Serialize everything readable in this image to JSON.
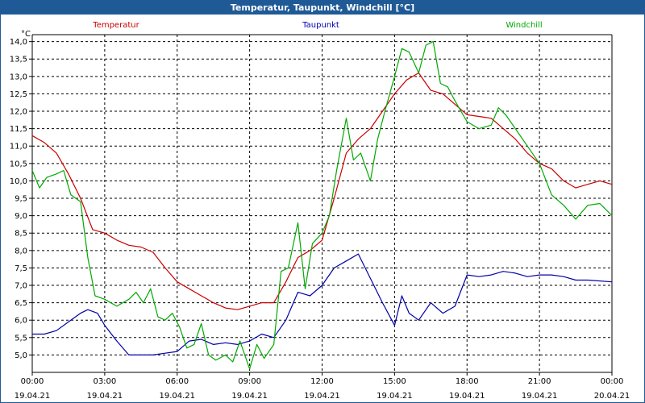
{
  "window_title": "Temperatur, Taupunkt, Windchill [°C]",
  "colors": {
    "titlebar": "#1f5a96",
    "temperatur": "#cc0000",
    "taupunkt": "#0000aa",
    "windchill": "#00aa00",
    "grid": "#000000"
  },
  "chart_data": {
    "type": "line",
    "title": "Temperatur, Taupunkt, Windchill [°C]",
    "ylabel": "°C",
    "ylim": [
      4.5,
      14.2
    ],
    "xlim": [
      0,
      24
    ],
    "grid": true,
    "yticks": [
      "5,0",
      "5,5",
      "6,0",
      "6,5",
      "7,0",
      "7,5",
      "8,0",
      "8,5",
      "9,0",
      "9,5",
      "10,0",
      "10,5",
      "11,0",
      "11,5",
      "12,0",
      "12,5",
      "13,0",
      "13,5",
      "14,0"
    ],
    "xticks": [
      {
        "time": "00:00",
        "date": "19.04.21"
      },
      {
        "time": "03:00",
        "date": "19.04.21"
      },
      {
        "time": "06:00",
        "date": "19.04.21"
      },
      {
        "time": "09:00",
        "date": "19.04.21"
      },
      {
        "time": "12:00",
        "date": "19.04.21"
      },
      {
        "time": "15:00",
        "date": "19.04.21"
      },
      {
        "time": "18:00",
        "date": "19.04.21"
      },
      {
        "time": "21:00",
        "date": "19.04.21"
      },
      {
        "time": "00:00",
        "date": "20.04.21"
      }
    ],
    "series": [
      {
        "name": "Temperatur",
        "color": "#cc0000",
        "points": [
          [
            0,
            11.3
          ],
          [
            0.5,
            11.1
          ],
          [
            1,
            10.8
          ],
          [
            1.5,
            10.2
          ],
          [
            2,
            9.5
          ],
          [
            2.5,
            8.6
          ],
          [
            3,
            8.5
          ],
          [
            3.5,
            8.3
          ],
          [
            4,
            8.15
          ],
          [
            4.5,
            8.1
          ],
          [
            5,
            7.95
          ],
          [
            5.5,
            7.5
          ],
          [
            6,
            7.1
          ],
          [
            6.5,
            6.9
          ],
          [
            7,
            6.7
          ],
          [
            7.5,
            6.5
          ],
          [
            8,
            6.35
          ],
          [
            8.5,
            6.3
          ],
          [
            9,
            6.4
          ],
          [
            9.5,
            6.5
          ],
          [
            10,
            6.5
          ],
          [
            10.5,
            7.1
          ],
          [
            11,
            7.8
          ],
          [
            11.5,
            8.0
          ],
          [
            12,
            8.3
          ],
          [
            12.5,
            9.5
          ],
          [
            13,
            10.8
          ],
          [
            13.5,
            11.2
          ],
          [
            14,
            11.5
          ],
          [
            14.5,
            12.0
          ],
          [
            15,
            12.5
          ],
          [
            15.5,
            12.9
          ],
          [
            16,
            13.1
          ],
          [
            16.5,
            12.6
          ],
          [
            17,
            12.5
          ],
          [
            17.5,
            12.2
          ],
          [
            18,
            11.9
          ],
          [
            18.5,
            11.85
          ],
          [
            19,
            11.8
          ],
          [
            19.5,
            11.5
          ],
          [
            20,
            11.2
          ],
          [
            20.5,
            10.8
          ],
          [
            21,
            10.5
          ],
          [
            21.5,
            10.35
          ],
          [
            22,
            10.0
          ],
          [
            22.5,
            9.8
          ],
          [
            23,
            9.9
          ],
          [
            23.5,
            10.0
          ],
          [
            24,
            9.9
          ]
        ]
      },
      {
        "name": "Taupunkt",
        "color": "#0000aa",
        "points": [
          [
            0,
            5.6
          ],
          [
            0.5,
            5.6
          ],
          [
            1,
            5.7
          ],
          [
            1.5,
            5.95
          ],
          [
            2,
            6.2
          ],
          [
            2.3,
            6.3
          ],
          [
            2.7,
            6.2
          ],
          [
            3,
            5.85
          ],
          [
            3.5,
            5.4
          ],
          [
            4,
            5.0
          ],
          [
            4.5,
            5.0
          ],
          [
            5,
            5.0
          ],
          [
            5.5,
            5.05
          ],
          [
            6,
            5.1
          ],
          [
            6.5,
            5.4
          ],
          [
            7,
            5.45
          ],
          [
            7.5,
            5.3
          ],
          [
            8,
            5.35
          ],
          [
            8.5,
            5.3
          ],
          [
            9,
            5.4
          ],
          [
            9.5,
            5.6
          ],
          [
            10,
            5.5
          ],
          [
            10.5,
            6.0
          ],
          [
            11,
            6.8
          ],
          [
            11.5,
            6.7
          ],
          [
            12,
            7.0
          ],
          [
            12.5,
            7.5
          ],
          [
            13,
            7.7
          ],
          [
            13.5,
            7.9
          ],
          [
            14,
            7.2
          ],
          [
            14.5,
            6.5
          ],
          [
            15,
            5.85
          ],
          [
            15.3,
            6.7
          ],
          [
            15.6,
            6.2
          ],
          [
            16,
            6.0
          ],
          [
            16.5,
            6.5
          ],
          [
            17,
            6.2
          ],
          [
            17.5,
            6.4
          ],
          [
            18,
            7.3
          ],
          [
            18.5,
            7.25
          ],
          [
            19,
            7.3
          ],
          [
            19.5,
            7.4
          ],
          [
            20,
            7.35
          ],
          [
            20.5,
            7.25
          ],
          [
            21,
            7.3
          ],
          [
            21.5,
            7.3
          ],
          [
            22,
            7.25
          ],
          [
            22.5,
            7.15
          ],
          [
            23,
            7.15
          ],
          [
            24,
            7.1
          ]
        ]
      },
      {
        "name": "Windchill",
        "color": "#00aa00",
        "points": [
          [
            0,
            10.3
          ],
          [
            0.3,
            9.8
          ],
          [
            0.6,
            10.1
          ],
          [
            1,
            10.2
          ],
          [
            1.3,
            10.3
          ],
          [
            1.6,
            9.6
          ],
          [
            2,
            9.4
          ],
          [
            2.3,
            7.8
          ],
          [
            2.6,
            6.7
          ],
          [
            3,
            6.6
          ],
          [
            3.5,
            6.4
          ],
          [
            4,
            6.6
          ],
          [
            4.3,
            6.8
          ],
          [
            4.6,
            6.5
          ],
          [
            4.9,
            6.9
          ],
          [
            5.2,
            6.1
          ],
          [
            5.5,
            6.0
          ],
          [
            5.8,
            6.2
          ],
          [
            6.1,
            5.8
          ],
          [
            6.4,
            5.2
          ],
          [
            6.7,
            5.3
          ],
          [
            7,
            5.9
          ],
          [
            7.3,
            5.0
          ],
          [
            7.6,
            4.85
          ],
          [
            8,
            5.0
          ],
          [
            8.3,
            4.8
          ],
          [
            8.6,
            5.4
          ],
          [
            9,
            4.6
          ],
          [
            9.3,
            5.3
          ],
          [
            9.6,
            4.9
          ],
          [
            10,
            5.3
          ],
          [
            10.3,
            7.4
          ],
          [
            10.6,
            7.5
          ],
          [
            11,
            8.8
          ],
          [
            11.3,
            6.9
          ],
          [
            11.6,
            8.2
          ],
          [
            12,
            8.5
          ],
          [
            12.3,
            9.0
          ],
          [
            12.6,
            10.3
          ],
          [
            13,
            11.8
          ],
          [
            13.3,
            10.6
          ],
          [
            13.6,
            10.8
          ],
          [
            14,
            10.0
          ],
          [
            14.3,
            11.2
          ],
          [
            14.6,
            12.0
          ],
          [
            15,
            13.0
          ],
          [
            15.3,
            13.8
          ],
          [
            15.6,
            13.7
          ],
          [
            16,
            13.1
          ],
          [
            16.3,
            13.9
          ],
          [
            16.6,
            14.0
          ],
          [
            16.9,
            12.8
          ],
          [
            17.2,
            12.7
          ],
          [
            17.5,
            12.3
          ],
          [
            18,
            11.7
          ],
          [
            18.5,
            11.5
          ],
          [
            19,
            11.6
          ],
          [
            19.3,
            12.1
          ],
          [
            19.6,
            11.9
          ],
          [
            20,
            11.5
          ],
          [
            20.5,
            11.0
          ],
          [
            21,
            10.5
          ],
          [
            21.5,
            9.6
          ],
          [
            22,
            9.3
          ],
          [
            22.5,
            8.9
          ],
          [
            23,
            9.3
          ],
          [
            23.5,
            9.35
          ],
          [
            24,
            9.0
          ]
        ]
      }
    ]
  }
}
